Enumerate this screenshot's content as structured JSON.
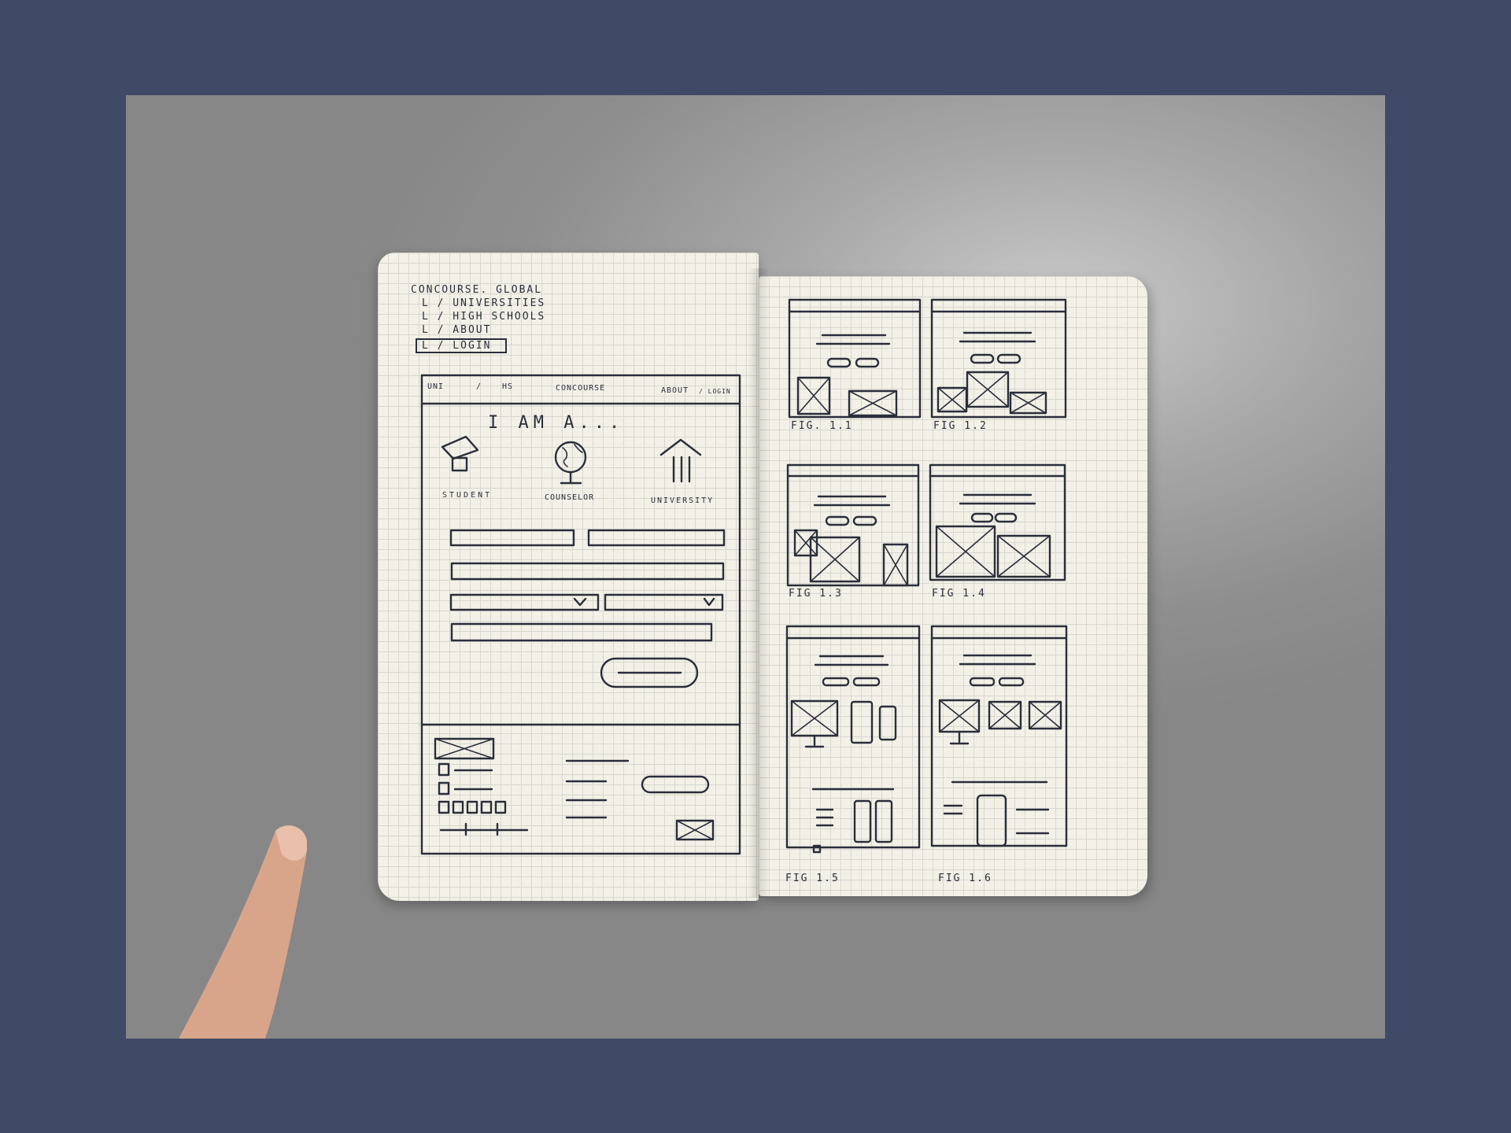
{
  "sitemap": {
    "root": "CONCOURSE. GLOBAL",
    "items": [
      "L / UNIVERSITIES",
      "L / HIGH SCHOOLS",
      "L / ABOUT",
      "L / LOGIN"
    ]
  },
  "wireframe_main": {
    "nav": {
      "uni": "UNI",
      "sep": "/",
      "hs": "HS",
      "brand": "CONCOURSE",
      "about": "ABOUT",
      "login": "/ LOGIN"
    },
    "headline": "I AM A...",
    "roles": [
      {
        "label": "STUDENT",
        "icon": "graduation-cap-icon"
      },
      {
        "label": "COUNSELOR",
        "icon": "globe-icon"
      },
      {
        "label": "UNIVERSITY",
        "icon": "building-icon"
      }
    ]
  },
  "figures": [
    "FIG. 1.1",
    "FIG 1.2",
    "FIG 1.3",
    "FIG 1.4",
    "FIG 1.5",
    "FIG 1.6"
  ],
  "colors": {
    "frame": "#3e4a66",
    "paper": "#f3f1e7",
    "ink": "#2a2e3a",
    "surface": "#9a9a9a"
  }
}
